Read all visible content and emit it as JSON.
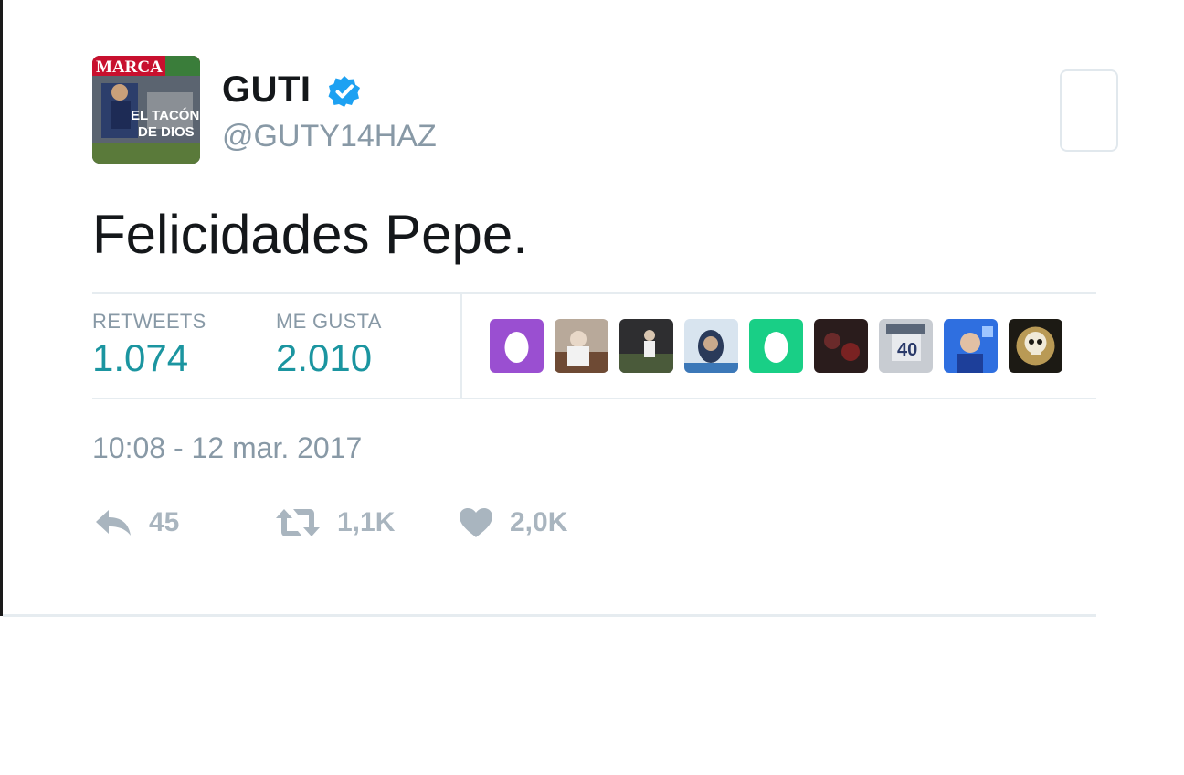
{
  "tweet": {
    "author": {
      "display_name": "GUTI",
      "handle": "@GUTY14HAZ",
      "verified": true,
      "avatar_text": [
        "MARCA",
        "EL TACÓN",
        "DE DIOS"
      ]
    },
    "text": "Felicidades Pepe.",
    "stats": {
      "retweets_label": "RETWEETS",
      "retweets_value": "1.074",
      "likes_label": "ME GUSTA",
      "likes_value": "2.010"
    },
    "likers": [
      "egg-avatar-purple",
      "photo-avatar",
      "photo-avatar",
      "photo-avatar",
      "egg-avatar-green",
      "photo-avatar",
      "photo-avatar",
      "photo-avatar",
      "skull-avatar"
    ],
    "timestamp": "10:08 - 12 mar. 2017",
    "actions": {
      "reply_count": "45",
      "retweet_count": "1,1K",
      "like_count": "2,0K"
    }
  },
  "colors": {
    "text": "#14171a",
    "muted": "#8899a6",
    "stat_value": "#1b95a0",
    "verified": "#1da1f2",
    "rule": "#e6ecf0"
  }
}
